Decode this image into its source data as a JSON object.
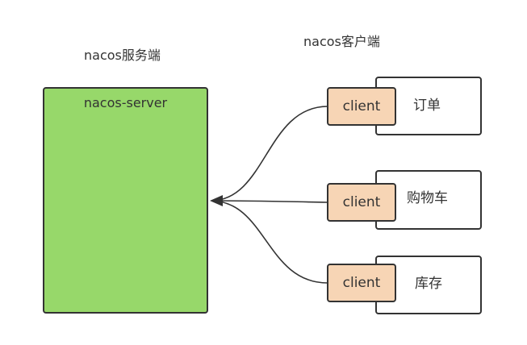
{
  "server_group": {
    "caption": "nacos服务端",
    "box_label": "nacos-server",
    "color": "#97d86a"
  },
  "client_group": {
    "caption": "nacos客户端",
    "client_color": "#f7d5b5"
  },
  "services": [
    {
      "name": "订单",
      "client_label": "client"
    },
    {
      "name": "购物车",
      "client_label": "client"
    },
    {
      "name": "库存",
      "client_label": "client"
    }
  ]
}
